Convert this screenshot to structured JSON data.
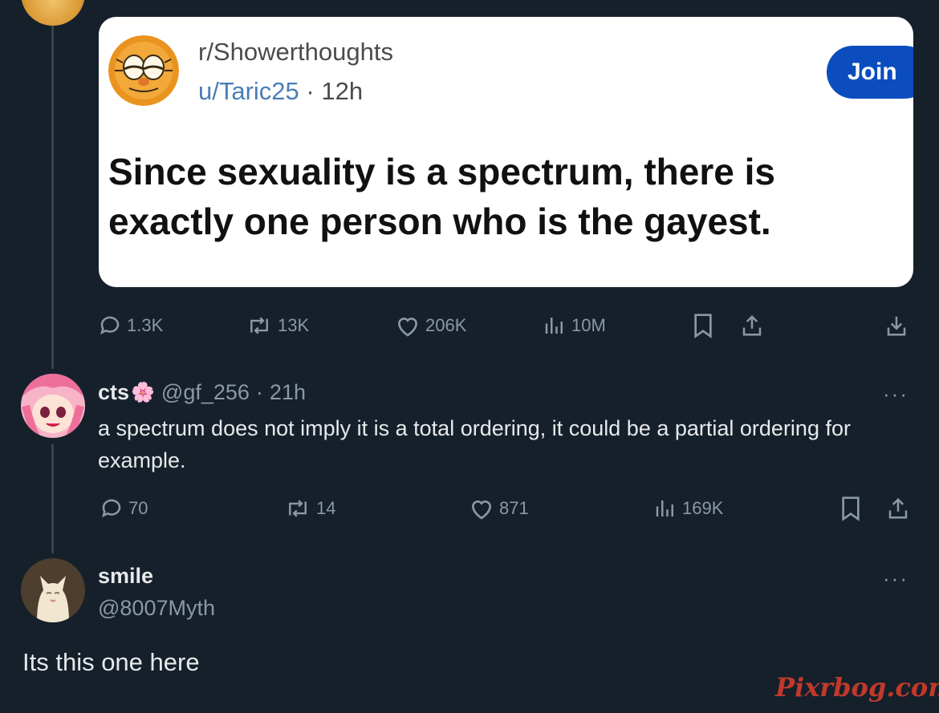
{
  "embedded_post": {
    "subreddit": "r/Showerthoughts",
    "username": "u/Taric25",
    "separator": "·",
    "time": "12h",
    "join_label": "Join",
    "text": "Since sexuality is a spectrum, there is exactly one person who is the gayest."
  },
  "post_actions": {
    "replies": "1.3K",
    "reposts": "13K",
    "likes": "206K",
    "views": "10M"
  },
  "reply": {
    "display_name": "cts",
    "emoji": "🌸",
    "handle": "@gf_256",
    "separator": "·",
    "time": "21h",
    "more": "···",
    "text": "a spectrum does not imply it is a total ordering, it could be a partial ordering for example.",
    "actions": {
      "replies": "70",
      "reposts": "14",
      "likes": "871",
      "views": "169K"
    }
  },
  "main_tweet": {
    "display_name": "smile",
    "handle": "@8007Myth",
    "more": "···",
    "text": "Its this one here"
  },
  "watermark": "Pixrbog.com",
  "colors": {
    "background": "#15202b",
    "muted": "#8b98a5",
    "join_button": "#0b4dbf",
    "watermark": "#c0392b"
  }
}
